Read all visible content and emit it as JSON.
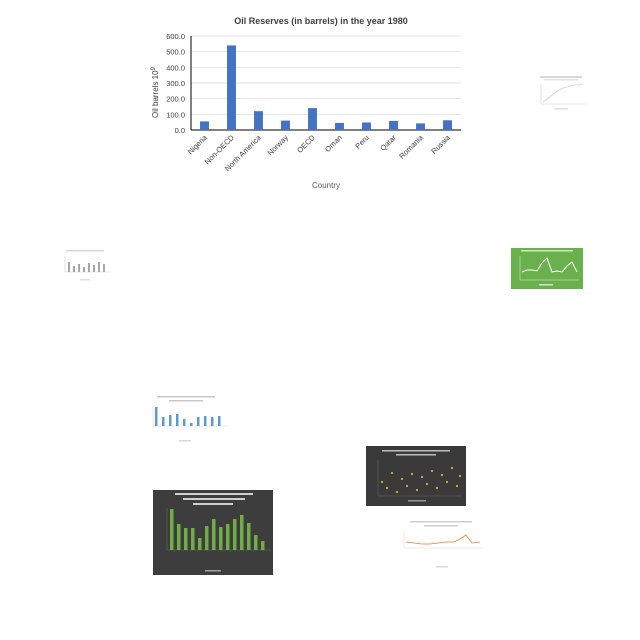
{
  "chart_data": [
    {
      "type": "bar",
      "title": "Oil Reserves (in barrels) in the year 1980",
      "xlabel": "Country",
      "ylabel": "Oil barrels 10",
      "ylabel_exponent": "9",
      "ylim": [
        0,
        600
      ],
      "yticks": [
        "0.0",
        "100.0",
        "200.0",
        "300.0",
        "400.0",
        "500.0",
        "600.0"
      ],
      "categories": [
        "Nigeria",
        "Non-OECD",
        "North America",
        "Norway",
        "OECD",
        "Oman",
        "Peru",
        "Qatar",
        "Romania",
        "Russia"
      ],
      "values": [
        55,
        540,
        120,
        60,
        140,
        45,
        48,
        58,
        42,
        62
      ],
      "grid": true,
      "bar_color": "#4472c4"
    }
  ],
  "thumbnails": [
    {
      "name": "thumb-scatter-white",
      "theme": "white"
    },
    {
      "name": "thumb-bar-gray",
      "theme": "white"
    },
    {
      "name": "thumb-line-green",
      "theme": "green"
    },
    {
      "name": "thumb-bar-blue",
      "theme": "white"
    },
    {
      "name": "thumb-scatter-dark",
      "theme": "dark"
    },
    {
      "name": "thumb-bar-dark-green",
      "theme": "dark"
    },
    {
      "name": "thumb-line-orange",
      "theme": "white"
    }
  ]
}
